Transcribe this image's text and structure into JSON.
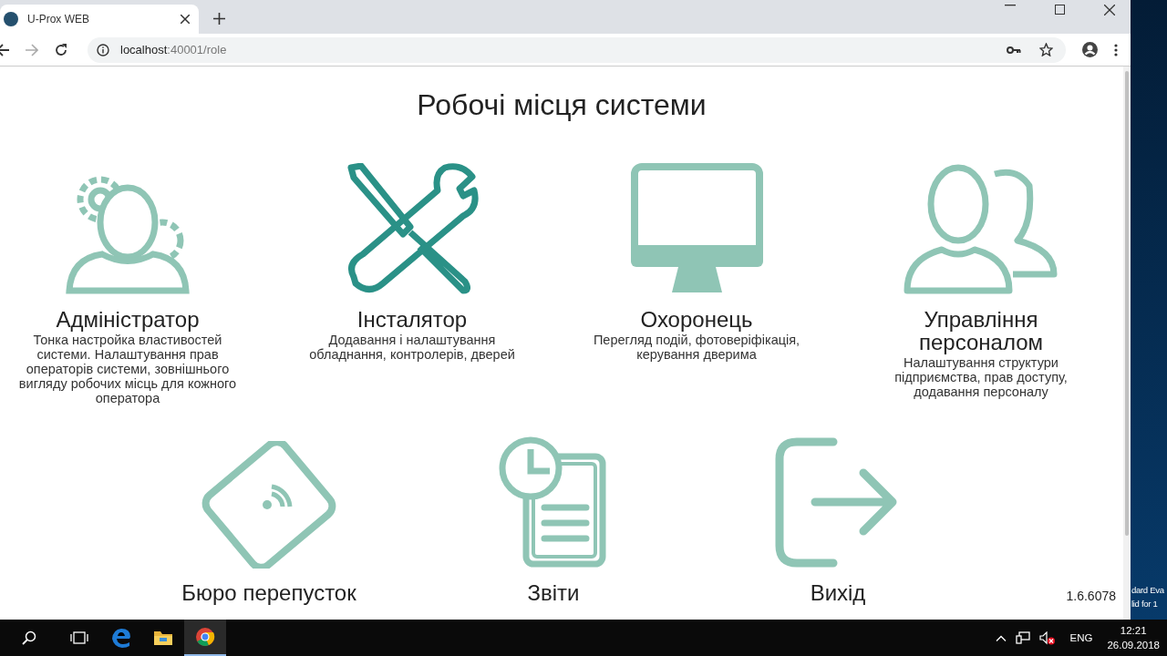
{
  "browser": {
    "tab": {
      "title": "U-Prox WEB",
      "selected": true
    },
    "address": {
      "host": "localhost",
      "path": ":40001/role"
    }
  },
  "page": {
    "title": "Робочі місця системи",
    "version": "1.6.6078",
    "rows": [
      [
        {
          "kind": "admin",
          "title": "Адміністратор",
          "description": "Тонка настройка властивостей системи. Налаштування прав операторів системи, зовнішнього вигляду робочих місць для кожного оператора"
        },
        {
          "kind": "installer",
          "title": "Інсталятор",
          "description": "Додавання і налаштування обладнання, контролерів, дверей"
        },
        {
          "kind": "guard",
          "title": "Охоронець",
          "description": "Перегляд подій, фотоверіфікація, керування дверима"
        },
        {
          "kind": "personnel",
          "title": "Управління персоналом",
          "description": "Налаштування структури підприємства, прав доступу, додавання персоналу"
        }
      ],
      [
        {
          "kind": "passes",
          "title": "Бюро перепусток"
        },
        {
          "kind": "reports",
          "title": "Звіти"
        },
        {
          "kind": "exit",
          "title": "Вихід"
        }
      ]
    ]
  },
  "desktop": {
    "lines": [
      "dard Eva",
      "lid for 1"
    ]
  },
  "taskbar": {
    "apps": [
      {
        "kind": "search"
      },
      {
        "kind": "taskview"
      },
      {
        "kind": "edge"
      },
      {
        "kind": "explorer"
      },
      {
        "kind": "chrome",
        "selected": true
      }
    ],
    "tray": {
      "language": "ENG",
      "time": "12:21",
      "date": "26.09.2018"
    }
  }
}
